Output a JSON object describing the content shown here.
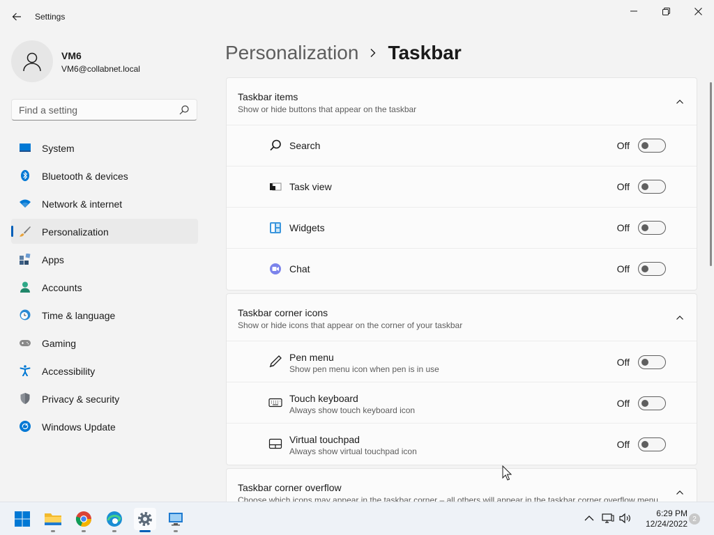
{
  "window": {
    "title": "Settings"
  },
  "profile": {
    "name": "VM6",
    "email": "VM6@collabnet.local"
  },
  "search": {
    "placeholder": "Find a setting"
  },
  "sidebar": {
    "items": [
      {
        "label": "System",
        "icon": "system-icon"
      },
      {
        "label": "Bluetooth & devices",
        "icon": "bluetooth-icon"
      },
      {
        "label": "Network & internet",
        "icon": "wifi-icon"
      },
      {
        "label": "Personalization",
        "icon": "brush-icon",
        "active": true
      },
      {
        "label": "Apps",
        "icon": "apps-icon"
      },
      {
        "label": "Accounts",
        "icon": "accounts-icon"
      },
      {
        "label": "Time & language",
        "icon": "clock-globe-icon"
      },
      {
        "label": "Gaming",
        "icon": "controller-icon"
      },
      {
        "label": "Accessibility",
        "icon": "accessibility-icon"
      },
      {
        "label": "Privacy & security",
        "icon": "shield-icon"
      },
      {
        "label": "Windows Update",
        "icon": "update-icon"
      }
    ]
  },
  "breadcrumb": {
    "parent": "Personalization",
    "current": "Taskbar"
  },
  "sections": {
    "items": {
      "title": "Taskbar items",
      "desc": "Show or hide buttons that appear on the taskbar",
      "rows": [
        {
          "label": "Search",
          "state": "Off",
          "icon": "search-icon"
        },
        {
          "label": "Task view",
          "state": "Off",
          "icon": "task-view-icon"
        },
        {
          "label": "Widgets",
          "state": "Off",
          "icon": "widgets-icon"
        },
        {
          "label": "Chat",
          "state": "Off",
          "icon": "chat-icon"
        }
      ]
    },
    "corner": {
      "title": "Taskbar corner icons",
      "desc": "Show or hide icons that appear on the corner of your taskbar",
      "rows": [
        {
          "label": "Pen menu",
          "desc": "Show pen menu icon when pen is in use",
          "state": "Off",
          "icon": "pen-icon"
        },
        {
          "label": "Touch keyboard",
          "desc": "Always show touch keyboard icon",
          "state": "Off",
          "icon": "keyboard-icon"
        },
        {
          "label": "Virtual touchpad",
          "desc": "Always show virtual touchpad icon",
          "state": "Off",
          "icon": "touchpad-icon"
        }
      ]
    },
    "overflow": {
      "title": "Taskbar corner overflow",
      "desc": "Choose which icons may appear in the taskbar corner – all others will appear in the taskbar corner overflow menu"
    }
  },
  "taskbar": {
    "apps": [
      "start-icon",
      "file-explorer-icon",
      "chrome-icon",
      "edge-icon",
      "settings-icon",
      "remote-desktop-icon"
    ],
    "clock": {
      "time": "6:29 PM",
      "date": "12/24/2022"
    },
    "notifications": "2"
  },
  "colors": {
    "accent": "#005fb8",
    "background": "#f3f3f3",
    "card": "#fbfbfb"
  }
}
